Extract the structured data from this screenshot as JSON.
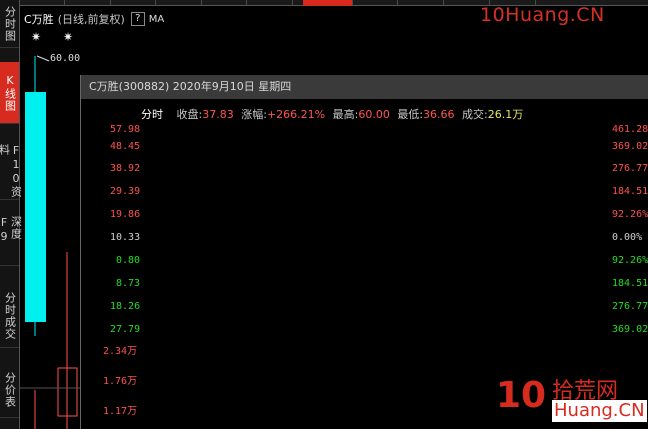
{
  "header": {
    "stock_name": "C万胜",
    "period_info": "(日线,前复权)",
    "help_label": "?",
    "ma_label": "MA"
  },
  "watermark": {
    "top_text": "10Huang.CN",
    "logo_digits": "10",
    "logo_cn": "拾荒网",
    "logo_domain": "Huang.CN"
  },
  "sidebar": {
    "items": [
      {
        "label": "分时图"
      },
      {
        "label": "K线图"
      },
      {
        "label": "F10资料"
      },
      {
        "label": "深度F9"
      },
      {
        "label": "分时成交"
      },
      {
        "label": "分价表"
      }
    ]
  },
  "kline": {
    "high_price_label": "60.00",
    "stars": [
      "✷",
      "✷"
    ]
  },
  "popup": {
    "title": "C万胜(300882) 2020年9月10日 星期四",
    "tab_label": "分时",
    "close_label": "收盘:",
    "close_value": "37.83",
    "change_label": "涨幅:",
    "change_value": "+266.21%",
    "high_label": "最高:",
    "high_value": "60.00",
    "low_label": "最低:",
    "low_value": "36.66",
    "volume_label": "成交:",
    "volume_value": "26.1万"
  },
  "price_axis": {
    "left_labels": [
      {
        "text": "57.98",
        "color": "red"
      },
      {
        "text": "48.45",
        "color": "red"
      },
      {
        "text": "38.92",
        "color": "red"
      },
      {
        "text": "29.39",
        "color": "red"
      },
      {
        "text": "19.86",
        "color": "red"
      },
      {
        "text": "10.33",
        "color": "white"
      },
      {
        "text": "0.80",
        "color": "green"
      },
      {
        "text": "8.73",
        "color": "green"
      },
      {
        "text": "18.26",
        "color": "green"
      },
      {
        "text": "27.79",
        "color": "green"
      }
    ],
    "right_labels": [
      {
        "text": "461.28",
        "color": "red"
      },
      {
        "text": "369.02",
        "color": "red"
      },
      {
        "text": "276.77",
        "color": "red"
      },
      {
        "text": "184.51",
        "color": "red"
      },
      {
        "text": "92.26%",
        "color": "red"
      },
      {
        "text": "0.00%",
        "color": "white"
      },
      {
        "text": "92.26%",
        "color": "green"
      },
      {
        "text": "184.51",
        "color": "green"
      },
      {
        "text": "276.77",
        "color": "green"
      },
      {
        "text": "369.02",
        "color": "green"
      }
    ]
  },
  "volume_axis": {
    "labels": [
      "2.34万",
      "1.76万",
      "1.17万"
    ]
  },
  "colors": {
    "up": "#ff5050",
    "down": "#22dd22",
    "candle_body": "#00f0f0",
    "price_line": "#e8e8e8",
    "avg_line": "#e8e860",
    "accent": "#d62b1e"
  }
}
